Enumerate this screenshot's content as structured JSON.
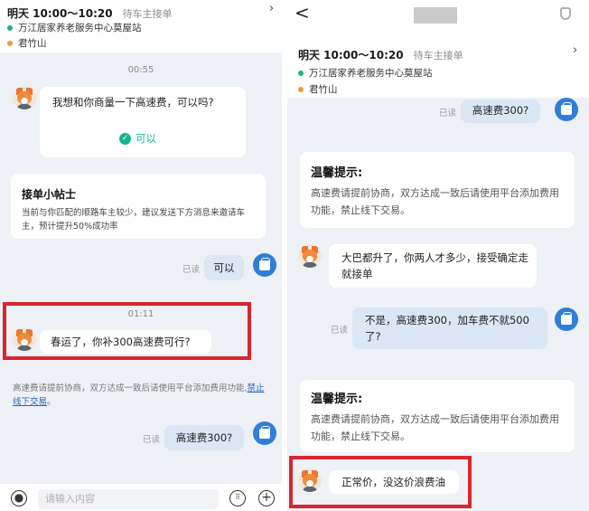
{
  "left": {
    "info": {
      "time": "明天 10:00～10:20",
      "status": "待车主接单",
      "from": "万江居家养老服务中心莫屋站",
      "to": "君竹山"
    },
    "timestamp1": "00:55",
    "msg1": "我想和你商量一下高速费，可以吗?",
    "msg1_action": "可以",
    "tip_title": "接单小帖士",
    "tip_text": "当前与你匹配的顺路车主较少，建议发送下方消息来邀请车主，预计提升50%成功率",
    "read1": "已读",
    "reply1": "可以",
    "timestamp2": "01:11",
    "msg2": "春运了，你补300高速费可行?",
    "notice_text": "高速费请提前协商，双方达成一致后请使用平台添加费用功能,",
    "notice_link": "禁止线下交易",
    "notice_end": "。",
    "read2": "已读",
    "reply2": "高速费300?",
    "input_placeholder": "请输入内容"
  },
  "right": {
    "back": "<",
    "info": {
      "time": "明天 10:00～10:20",
      "status": "待车主接单",
      "from": "万江居家养老服务中心莫屋站",
      "to": "君竹山"
    },
    "read0": "已读",
    "reply0": "高速费300?",
    "tip1_title": "温馨提示:",
    "tip1_text": "高速费请提前协商，双方达成一致后请使用平台添加费用功能，禁止线下交易。",
    "msg1": "大巴都升了，你两人才多少，接受确定走就接单",
    "read1": "已读",
    "reply1": "不是，高速费300，加车费不就500了?",
    "tip2_title": "温馨提示:",
    "tip2_text": "高速费请提前协商，双方达成一致后请使用平台添加费用功能，禁止线下交易。",
    "msg2": "正常价，没这价浪费油"
  },
  "colors": {
    "highlight": "#d8262f",
    "accent": "#18b38a",
    "out_bubble": "#dbe7f5",
    "from_dot": "#22b573",
    "to_dot": "#f39c34"
  },
  "icons": [
    "chevron-right-icon",
    "back-arrow-icon",
    "phone-icon",
    "check-icon",
    "mic-icon",
    "keyboard-icon",
    "plus-icon",
    "fox-avatar-icon",
    "driver-avatar-icon"
  ]
}
